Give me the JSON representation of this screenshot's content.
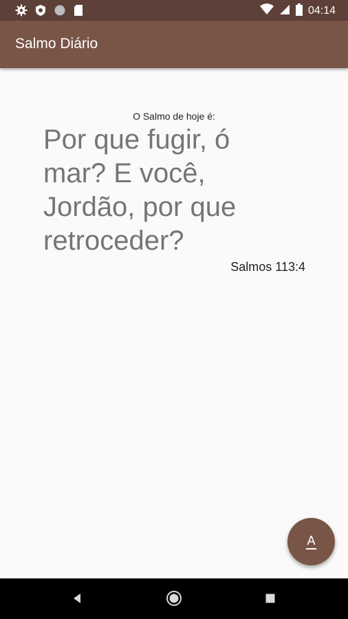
{
  "status_bar": {
    "time": "04:14",
    "left_icons": [
      "gear-icon",
      "shield-icon",
      "circle-icon",
      "sd-card-icon"
    ],
    "right_icons": [
      "wifi-icon",
      "signal-icon",
      "battery-icon"
    ]
  },
  "app_bar": {
    "title": "Salmo Diário"
  },
  "content": {
    "label": "O Salmo de hoje é:",
    "verse": "Por que fugir, ó mar? E você, Jordão, por que retroceder?",
    "reference": "Salmos 113:4"
  },
  "fab": {
    "label": "A",
    "icon": "font-size-icon"
  },
  "nav_bar": {
    "buttons": [
      "back-icon",
      "home-icon",
      "recents-icon"
    ]
  },
  "colors": {
    "status_bar": "#5d4037",
    "app_bar": "#795548",
    "background": "#fafafa",
    "verse_text": "#757575"
  }
}
